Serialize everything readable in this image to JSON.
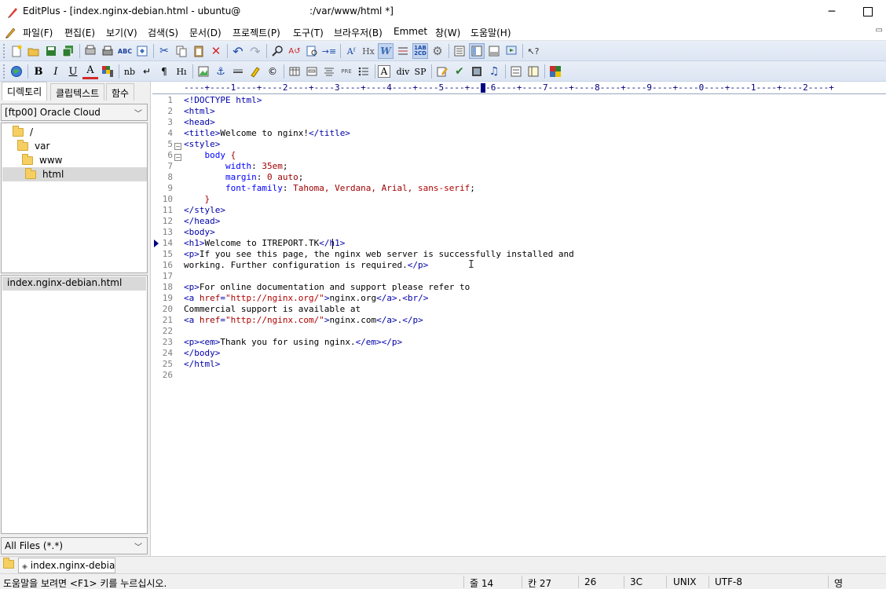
{
  "titlebar": {
    "title": "EditPlus - [index.nginx-debian.html - ubuntu@                       :/var/www/html *]",
    "minimize": "─",
    "maximize": "☐"
  },
  "menu": [
    "파일(F)",
    "편집(E)",
    "보기(V)",
    "검색(S)",
    "문서(D)",
    "프로젝트(P)",
    "도구(T)",
    "브라우저(B)",
    "Emmet",
    "창(W)",
    "도움말(H)"
  ],
  "left_panel": {
    "tabs": [
      "디렉토리",
      "클립텍스트",
      "함수"
    ],
    "drive": "[ftp00] Oracle Cloud",
    "tree": [
      "/",
      "var",
      "www",
      "html"
    ],
    "files": [
      "index.nginx-debian.html"
    ],
    "filter": "All Files (*.*)"
  },
  "ruler": "----+----1----+----2----+----3----+----4----+----5----+----6----+----7----+----8----+----9----+----0----+----1----+----2----+",
  "editor": {
    "lines": [
      "<!DOCTYPE html>",
      "<html>",
      "<head>",
      "<title>Welcome to nginx!</title>",
      "<style>",
      "    body {",
      "        width: 35em;",
      "        margin: 0 auto;",
      "        font-family: Tahoma, Verdana, Arial, sans-serif;",
      "    }",
      "</style>",
      "</head>",
      "<body>",
      "<h1>Welcome to ITREPORT.TK</h1>",
      "<p>If you see this page, the nginx web server is successfully installed and",
      "working. Further configuration is required.</p>",
      "",
      "<p>For online documentation and support please refer to",
      "<a href=\"http://nginx.org/\">nginx.org</a>.<br/>",
      "Commercial support is available at",
      "<a href=\"http://nginx.com/\">nginx.com</a>.</p>",
      "",
      "<p><em>Thank you for using nginx.</em></p>",
      "</body>",
      "</html>",
      ""
    ]
  },
  "doc_tabs": [
    "index.nginx-debia"
  ],
  "status": {
    "help": "도움말을 보려면 <F1> 키를 누르십시오.",
    "line": "줄 14",
    "col": "칸 27",
    "count": "26",
    "hex": "3C",
    "eol": "UNIX",
    "encoding": "UTF-8",
    "ime": "영"
  },
  "colors": {
    "tag": "#0000aa",
    "css_property": "#0000ff",
    "css_value": "#a00000",
    "toolbar_bg": "#dce5f3"
  },
  "icons": {
    "toolbar1": [
      "new-file-icon",
      "open-icon",
      "save-icon",
      "save-all-icon",
      "print-preview-icon",
      "print-icon",
      "spell-check-icon",
      "browser-preview-icon",
      "cut-icon",
      "copy-icon",
      "paste-icon",
      "delete-icon",
      "undo-icon",
      "redo-icon",
      "find-icon",
      "replace-icon",
      "find-in-files-icon",
      "goto-line-icon",
      "font-icon",
      "hex-icon",
      "word-wrap-icon",
      "column-icon",
      "line-number-icon",
      "settings-icon",
      "directory-window-icon",
      "cliptext-icon",
      "output-window-icon",
      "screen-icon",
      "help-icon"
    ],
    "toolbar2": [
      "html-globe-icon",
      "bold-icon",
      "italic-icon",
      "underline-icon",
      "font-color-icon",
      "color-picker-icon",
      "nbsp-icon",
      "br-icon",
      "paragraph-icon",
      "heading-icon",
      "image-icon",
      "anchor-icon",
      "hr-icon",
      "highlight-icon",
      "copyright-icon",
      "table-icon",
      "form-icon",
      "center-icon",
      "list-icon",
      "font-tag-icon",
      "div-icon",
      "span-icon",
      "edit-icon",
      "check-icon",
      "media-icon",
      "audio-icon",
      "frame-icon",
      "layout-icon",
      "palette-icon"
    ]
  }
}
